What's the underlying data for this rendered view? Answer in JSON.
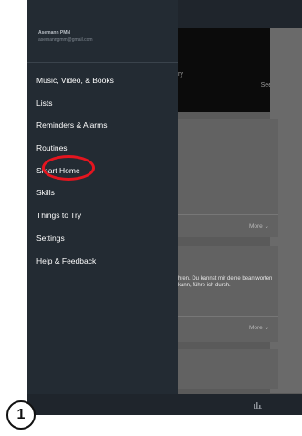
{
  "profile": {
    "name": "Asemann PMN",
    "email": "asemanngmm@gmail.com"
  },
  "menu": [
    {
      "label": "Music, Video, & Books"
    },
    {
      "label": "Lists"
    },
    {
      "label": "Reminders & Alarms"
    },
    {
      "label": "Routines"
    },
    {
      "label": "Smart Home"
    },
    {
      "label": "Skills"
    },
    {
      "label": "Things to Try"
    },
    {
      "label": "Settings"
    },
    {
      "label": "Help & Feedback"
    }
  ],
  "background": {
    "promo_fragment": "ry",
    "see_more": "See more",
    "card1_more": "More ⌄",
    "card2_text": "hren. Du kannst mir deine beantworten kann, führe ich durch.",
    "card2_more": "More ⌄"
  },
  "step": "1",
  "colors": {
    "drawer": "#232b33",
    "highlight": "#e4151f"
  }
}
